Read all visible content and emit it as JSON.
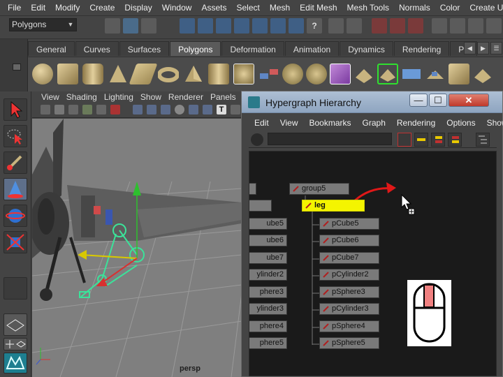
{
  "menubar": {
    "items": [
      "File",
      "Edit",
      "Modify",
      "Create",
      "Display",
      "Window",
      "Assets",
      "Select",
      "Mesh",
      "Edit Mesh",
      "Mesh Tools",
      "Normals",
      "Color",
      "Create UVs"
    ]
  },
  "statusline": {
    "mode_value": "Polygons"
  },
  "shelf": {
    "tabs": [
      "General",
      "Curves",
      "Surfaces",
      "Polygons",
      "Deformation",
      "Animation",
      "Dynamics",
      "Rendering",
      "Pa"
    ],
    "active_tab": "Polygons",
    "nav_left": "◀",
    "nav_right": "▶",
    "nav_menu": "☰"
  },
  "viewport": {
    "menu": [
      "View",
      "Shading",
      "Lighting",
      "Show",
      "Renderer",
      "Panels"
    ],
    "camera_label": "persp",
    "colors": {
      "grid_bg": "#7f7f7f",
      "joint": "#3be39a"
    }
  },
  "hypergraph": {
    "title": "Hypergraph Hierarchy",
    "btn_minimize": "—",
    "btn_maximize": "☐",
    "btn_close": "✕",
    "menu": [
      "Edit",
      "View",
      "Bookmarks",
      "Graph",
      "Rendering",
      "Options",
      "Show",
      "»"
    ],
    "nodes": {
      "group5": "group5",
      "leg": "leg",
      "children": [
        "pCube5",
        "pCube6",
        "pCube7",
        "pCylinder2",
        "pSphere3",
        "pCylinder3",
        "pSphere4",
        "pSphere5"
      ],
      "left_column": [
        "ube5",
        "ube6",
        "ube7",
        "ylinder2",
        "phere3",
        "ylinder3",
        "phere4",
        "phere5"
      ]
    },
    "colors": {
      "selected_node": "#f4f400",
      "drag_arrow": "#e01818"
    }
  }
}
